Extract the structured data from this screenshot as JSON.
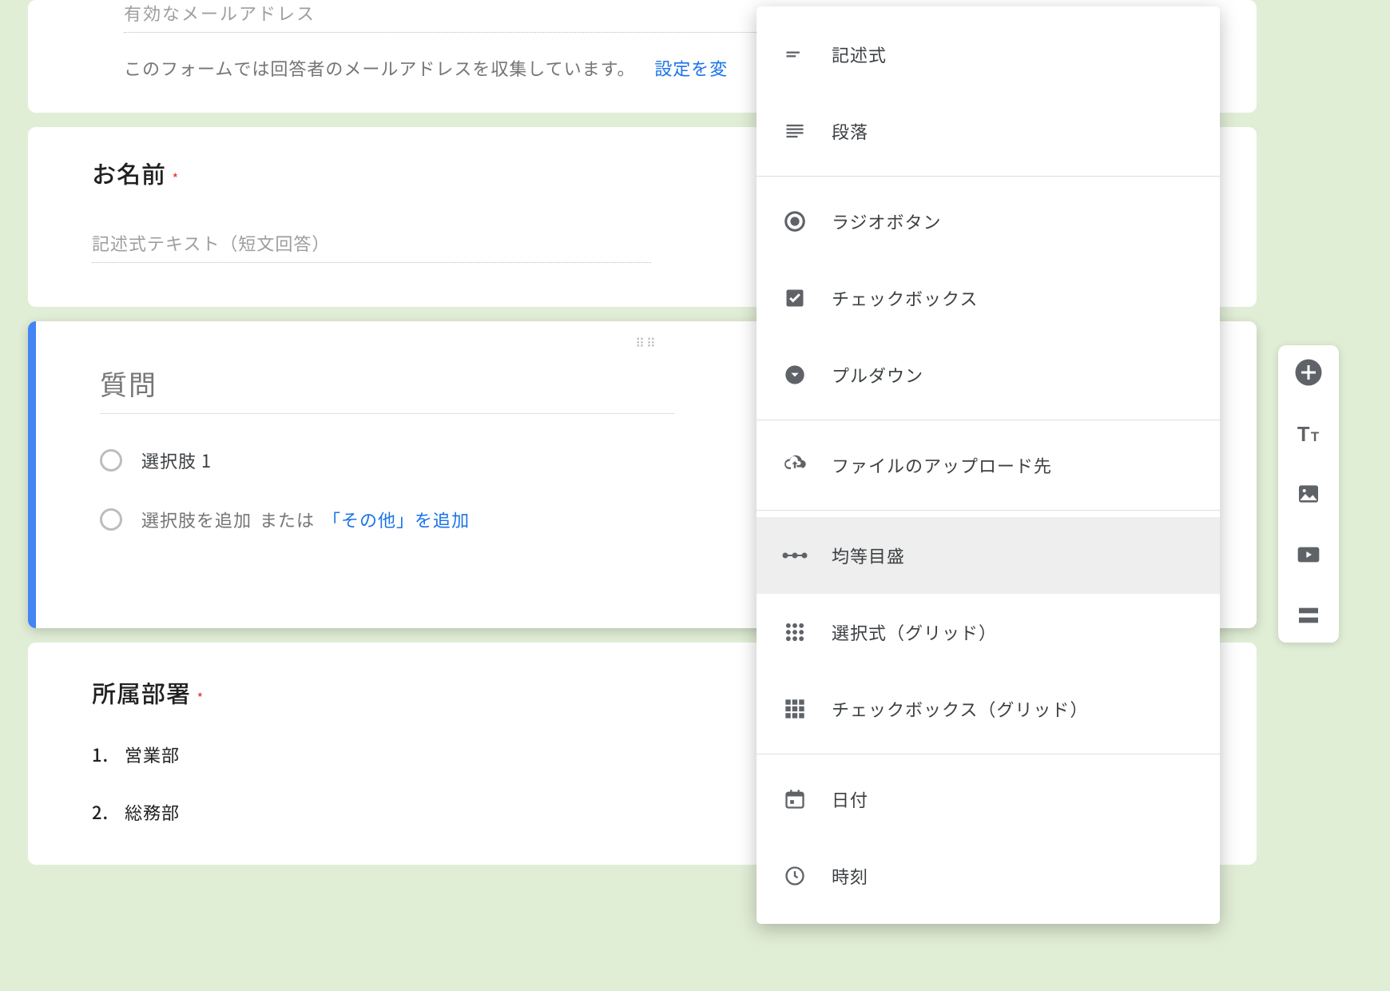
{
  "email_section": {
    "placeholder": "有効なメールアドレス",
    "collect_text": "このフォームでは回答者のメールアドレスを収集しています。",
    "settings_link": "設定を変"
  },
  "name_question": {
    "title": "お名前",
    "placeholder": "記述式テキスト（短文回答）"
  },
  "editing_question": {
    "placeholder": "質問",
    "option1": "選択肢 1",
    "add_option": "選択肢を追加",
    "or_text": "または",
    "add_other": "「その他」を追加"
  },
  "dept_question": {
    "title": "所属部署",
    "items": [
      "営業部",
      "総務部"
    ]
  },
  "dropdown": {
    "items": [
      {
        "label": "記述式",
        "icon": "short-text"
      },
      {
        "label": "段落",
        "icon": "paragraph"
      },
      {
        "label": "ラジオボタン",
        "icon": "radio"
      },
      {
        "label": "チェックボックス",
        "icon": "checkbox"
      },
      {
        "label": "プルダウン",
        "icon": "dropdown"
      },
      {
        "label": "ファイルのアップロード先",
        "icon": "upload"
      },
      {
        "label": "均等目盛",
        "icon": "linear-scale"
      },
      {
        "label": "選択式（グリッド）",
        "icon": "radio-grid"
      },
      {
        "label": "チェックボックス（グリッド）",
        "icon": "checkbox-grid"
      },
      {
        "label": "日付",
        "icon": "date"
      },
      {
        "label": "時刻",
        "icon": "time"
      }
    ],
    "highlighted_index": 6
  },
  "toolbar": {
    "buttons": [
      "add",
      "title",
      "image",
      "video",
      "section"
    ]
  }
}
